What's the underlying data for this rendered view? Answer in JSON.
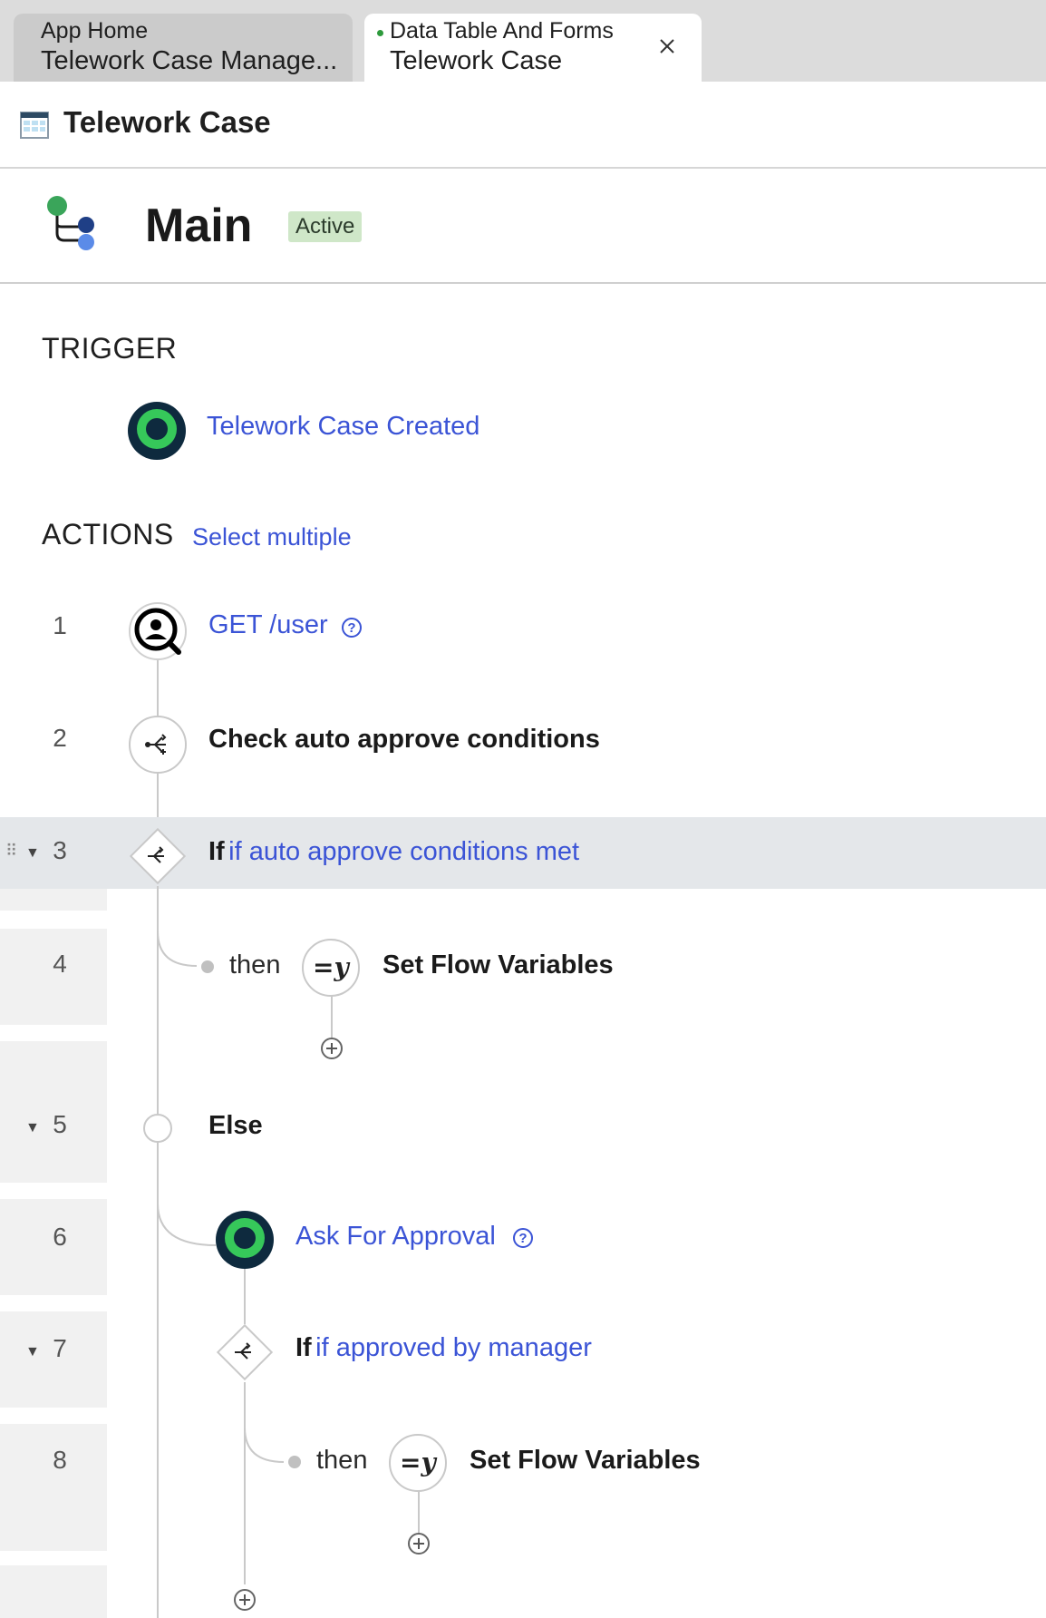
{
  "tabs": [
    {
      "line1": "App Home",
      "line2": "Telework Case Manage..."
    },
    {
      "line1": "Data Table And Forms",
      "line2": "Telework Case"
    }
  ],
  "header": {
    "title": "Telework Case"
  },
  "flow": {
    "name": "Main",
    "status": "Active"
  },
  "trigger": {
    "section": "TRIGGER",
    "label": "Telework Case Created"
  },
  "actions": {
    "section": "ACTIONS",
    "select_multiple": "Select multiple",
    "rows": [
      {
        "num": "1",
        "label": "GET /user"
      },
      {
        "num": "2",
        "label": "Check auto approve conditions"
      },
      {
        "num": "3",
        "keyword": "If",
        "label": "if auto approve conditions met"
      },
      {
        "num": "4",
        "prefix": "then",
        "label": "Set Flow Variables",
        "icon_text": "=y"
      },
      {
        "num": "5",
        "label": "Else"
      },
      {
        "num": "6",
        "label": "Ask For Approval"
      },
      {
        "num": "7",
        "keyword": "If",
        "label": "if approved by manager"
      },
      {
        "num": "8",
        "prefix": "then",
        "label": "Set Flow Variables",
        "icon_text": "=y"
      }
    ]
  },
  "colors": {
    "link": "#3b54d6",
    "active_badge": "#cfe7c8",
    "brand_green": "#36c85a",
    "brand_navy": "#0e2a3e"
  }
}
